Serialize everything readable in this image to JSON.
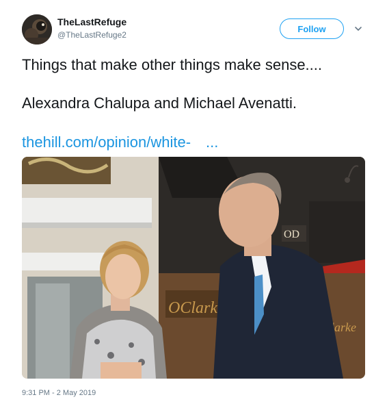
{
  "user": {
    "name": "TheLastRefuge",
    "handle": "@TheLastRefuge2"
  },
  "follow_button": {
    "label": "Follow"
  },
  "tweet": {
    "line1": "Things that make other things make sense....",
    "line2": "Alexandra Chalupa and Michael Avenatti.",
    "link_text": "thehill.com/opinion/white-",
    "link_ellipsis": "...",
    "timestamp": "9:31 PM - 2 May 2019"
  },
  "photo": {
    "storefront_sign_upper": "OD",
    "storefront_sign_script": "OClarke",
    "awning_script": "larke"
  },
  "colors": {
    "accent": "#1da1f2",
    "link": "#1b95e0",
    "secondary_text": "#657786"
  }
}
